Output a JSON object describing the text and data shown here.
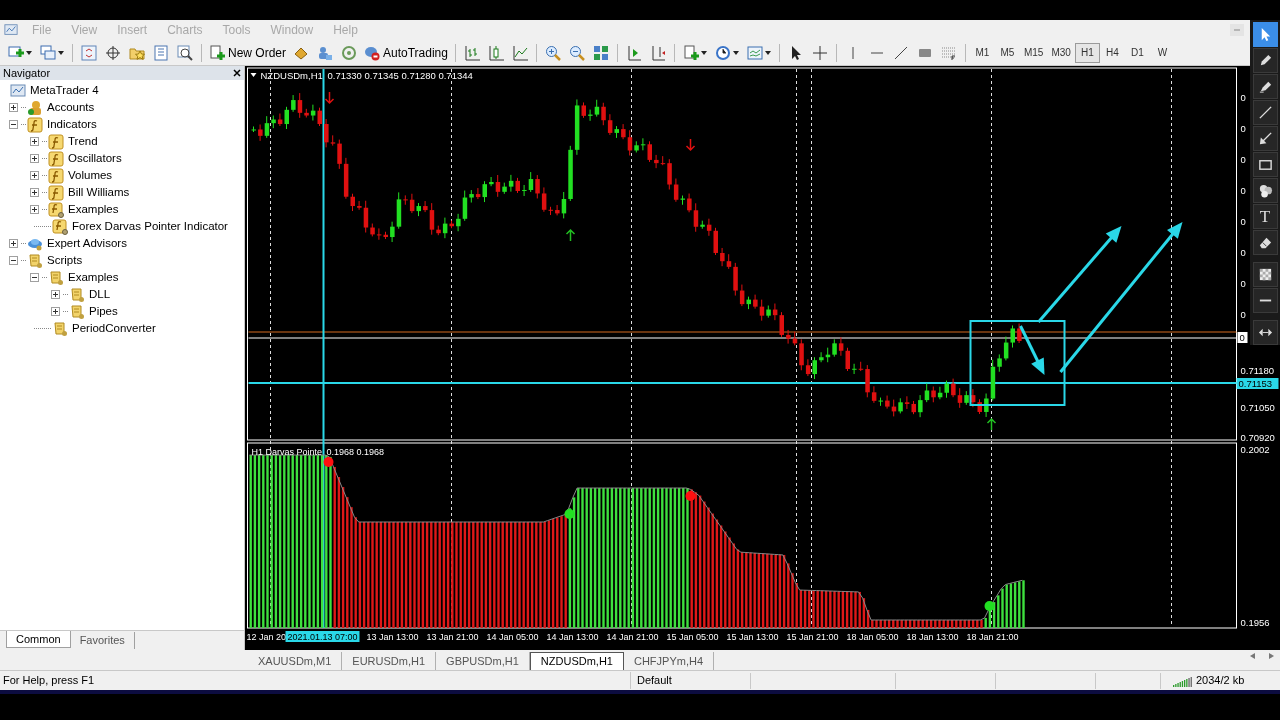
{
  "menu": [
    "File",
    "View",
    "Insert",
    "Charts",
    "Tools",
    "Window",
    "Help"
  ],
  "toolbar": [
    {
      "kind": "newchart",
      "caret": true
    },
    {
      "kind": "profiles",
      "caret": true
    },
    {
      "kind": "sep"
    },
    {
      "kind": "marketwatch"
    },
    {
      "kind": "datawindow"
    },
    {
      "kind": "favorites"
    },
    {
      "kind": "navigator"
    },
    {
      "kind": "tester"
    },
    {
      "kind": "sep"
    },
    {
      "kind": "neworder",
      "label": "New Order"
    },
    {
      "kind": "editor"
    },
    {
      "kind": "terminal"
    },
    {
      "kind": "signals"
    },
    {
      "kind": "autotrading",
      "label": "AutoTrading"
    },
    {
      "kind": "sep"
    },
    {
      "kind": "bars"
    },
    {
      "kind": "candles"
    },
    {
      "kind": "line"
    },
    {
      "kind": "sep"
    },
    {
      "kind": "zoomin"
    },
    {
      "kind": "zoomout"
    },
    {
      "kind": "tile"
    },
    {
      "kind": "sep"
    },
    {
      "kind": "autoscroll"
    },
    {
      "kind": "shift"
    },
    {
      "kind": "sep"
    },
    {
      "kind": "indicators",
      "caret": true
    },
    {
      "kind": "clock",
      "caret": true
    },
    {
      "kind": "templates",
      "caret": true
    },
    {
      "kind": "sep"
    },
    {
      "kind": "cursor"
    },
    {
      "kind": "cross"
    },
    {
      "kind": "sep"
    },
    {
      "kind": "vline"
    },
    {
      "kind": "hline"
    },
    {
      "kind": "trend"
    },
    {
      "kind": "rect"
    },
    {
      "kind": "fibo"
    },
    {
      "kind": "sep"
    }
  ],
  "periods": [
    {
      "label": "M1",
      "selected": false
    },
    {
      "label": "M5",
      "selected": false
    },
    {
      "label": "M15",
      "selected": false
    },
    {
      "label": "M30",
      "selected": false
    },
    {
      "label": "H1",
      "selected": true
    },
    {
      "label": "H4",
      "selected": false
    },
    {
      "label": "D1",
      "selected": false
    },
    {
      "label": "W",
      "selected": false
    }
  ],
  "navigator": {
    "title": "Navigator",
    "tree": [
      {
        "label": "MetaTrader 4",
        "kind": "terminal",
        "children": [
          {
            "label": "Accounts",
            "kind": "accounts",
            "expanded": false
          },
          {
            "label": "Indicators",
            "kind": "indicator",
            "expanded": true,
            "children": [
              {
                "label": "Trend",
                "kind": "indicator",
                "expanded": false
              },
              {
                "label": "Oscillators",
                "kind": "indicator",
                "expanded": false
              },
              {
                "label": "Volumes",
                "kind": "indicator",
                "expanded": false
              },
              {
                "label": "Bill Williams",
                "kind": "indicator",
                "expanded": false
              },
              {
                "label": "Examples",
                "kind": "custom",
                "expanded": false
              },
              {
                "label": "Forex Darvas Pointer Indicator",
                "kind": "custom"
              }
            ]
          },
          {
            "label": "Expert Advisors",
            "kind": "experts",
            "expanded": false
          },
          {
            "label": "Scripts",
            "kind": "script",
            "expanded": true,
            "children": [
              {
                "label": "Examples",
                "kind": "script",
                "expanded": true,
                "children": [
                  {
                    "label": "DLL",
                    "kind": "script",
                    "expanded": false
                  },
                  {
                    "label": "Pipes",
                    "kind": "script",
                    "expanded": false
                  }
                ]
              },
              {
                "label": "PeriodConverter",
                "kind": "script"
              }
            ]
          }
        ]
      }
    ],
    "tabs": [
      {
        "label": "Common",
        "selected": true
      },
      {
        "label": "Favorites",
        "selected": false
      }
    ]
  },
  "chart": {
    "symbol": "NZDUSDm,H1",
    "ohlc": "0.71330 0.71345 0.71280 0.71344",
    "price_labels": [
      {
        "text": "0"
      },
      {
        "text": "0"
      },
      {
        "text": "0"
      },
      {
        "text": "0"
      },
      {
        "text": "0"
      },
      {
        "text": "0"
      },
      {
        "text": "0"
      },
      {
        "text": "0"
      },
      {
        "text": "0",
        "kind": "boxed"
      },
      {
        "text": "0.71180"
      },
      {
        "text": "0.71153",
        "kind": "current"
      },
      {
        "text": "0.71050"
      },
      {
        "text": "0.70920"
      }
    ],
    "indicator": {
      "name": "H1 Darvas Pointe",
      "values": "0.1968 0.1968",
      "scale": [
        "0.2002",
        "0.1956"
      ]
    },
    "time_labels": [
      {
        "text": "12 Jan 20"
      },
      {
        "text": "2021.01.13 07:00",
        "kind": "current"
      },
      {
        "text": "13 Jan 13:00"
      },
      {
        "text": "13 Jan 21:00"
      },
      {
        "text": "14 Jan 05:00"
      },
      {
        "text": "14 Jan 13:00"
      },
      {
        "text": "14 Jan 21:00"
      },
      {
        "text": "15 Jan 05:00"
      },
      {
        "text": "15 Jan 13:00"
      },
      {
        "text": "15 Jan 21:00"
      },
      {
        "text": "18 Jan 05:00"
      },
      {
        "text": "18 Jan 13:00"
      },
      {
        "text": "18 Jan 21:00"
      }
    ]
  },
  "drawing_tools": [
    {
      "kind": "cursor",
      "selected": true
    },
    {
      "kind": "pencil",
      "selected": false
    },
    {
      "kind": "highlighter",
      "selected": false
    },
    {
      "kind": "line",
      "selected": false
    },
    {
      "kind": "arrow",
      "selected": false
    },
    {
      "kind": "rect",
      "selected": false
    },
    {
      "kind": "numbers",
      "selected": false
    },
    {
      "kind": "text",
      "label": "T",
      "selected": false
    },
    {
      "kind": "eraser",
      "selected": false
    },
    {
      "kind": "checker",
      "selected": false
    },
    {
      "kind": "hline",
      "selected": false
    },
    {
      "kind": "arrows",
      "selected": false
    }
  ],
  "chart_tabs": [
    {
      "label": "XAUUSDm,M1",
      "selected": false
    },
    {
      "label": "EURUSDm,H1",
      "selected": false
    },
    {
      "label": "GBPUSDm,H1",
      "selected": false
    },
    {
      "label": "NZDUSDm,H1",
      "selected": true
    },
    {
      "label": "CHFJPYm,H4",
      "selected": false
    }
  ],
  "status_bar": {
    "help": "For Help, press F1",
    "profile": "Default",
    "traffic": "2034/2 kb"
  }
}
